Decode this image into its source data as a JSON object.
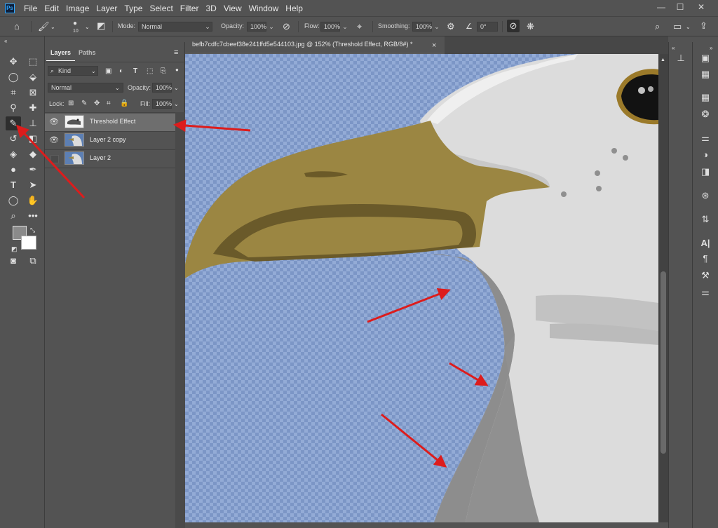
{
  "menu": {
    "logo": "Ps",
    "items": [
      "File",
      "Edit",
      "Image",
      "Layer",
      "Type",
      "Select",
      "Filter",
      "3D",
      "View",
      "Window",
      "Help"
    ]
  },
  "window_controls": {
    "minimize": "—",
    "maximize": "☐",
    "close": "✕"
  },
  "options_bar": {
    "brush_size": "10",
    "mode_label": "Mode:",
    "mode_value": "Normal",
    "opacity_label": "Opacity:",
    "opacity_value": "100%",
    "flow_label": "Flow:",
    "flow_value": "100%",
    "smoothing_label": "Smoothing:",
    "smoothing_value": "100%",
    "angle_value": "0°"
  },
  "layers_panel": {
    "tabs": [
      "Layers",
      "Paths"
    ],
    "filter_kind": "Kind",
    "blend_mode": "Normal",
    "opacity_label": "Opacity:",
    "opacity_value": "100%",
    "lock_label": "Lock:",
    "fill_label": "Fill:",
    "fill_value": "100%",
    "layers": [
      {
        "name": "Threshold Effect",
        "visible": true,
        "selected": true
      },
      {
        "name": "Layer 2 copy",
        "visible": true,
        "selected": false
      },
      {
        "name": "Layer 2",
        "visible": false,
        "selected": false
      }
    ]
  },
  "document": {
    "tab_title": "befb7cdfc7cbeef38e241ffd5e544103.jpg @ 152% (Threshold Effect, RGB/8#) *",
    "close": "×"
  },
  "colors": {
    "ui_bg": "#535353",
    "canvas_checker_a": "#7c96c6",
    "canvas_checker_b": "#93abd6",
    "beak": "#9b8642",
    "head": "#dcdcdc",
    "shadow": "#8d8d8d",
    "arrow": "#dd1c1c",
    "eye_ring": "#9b7a2a"
  }
}
